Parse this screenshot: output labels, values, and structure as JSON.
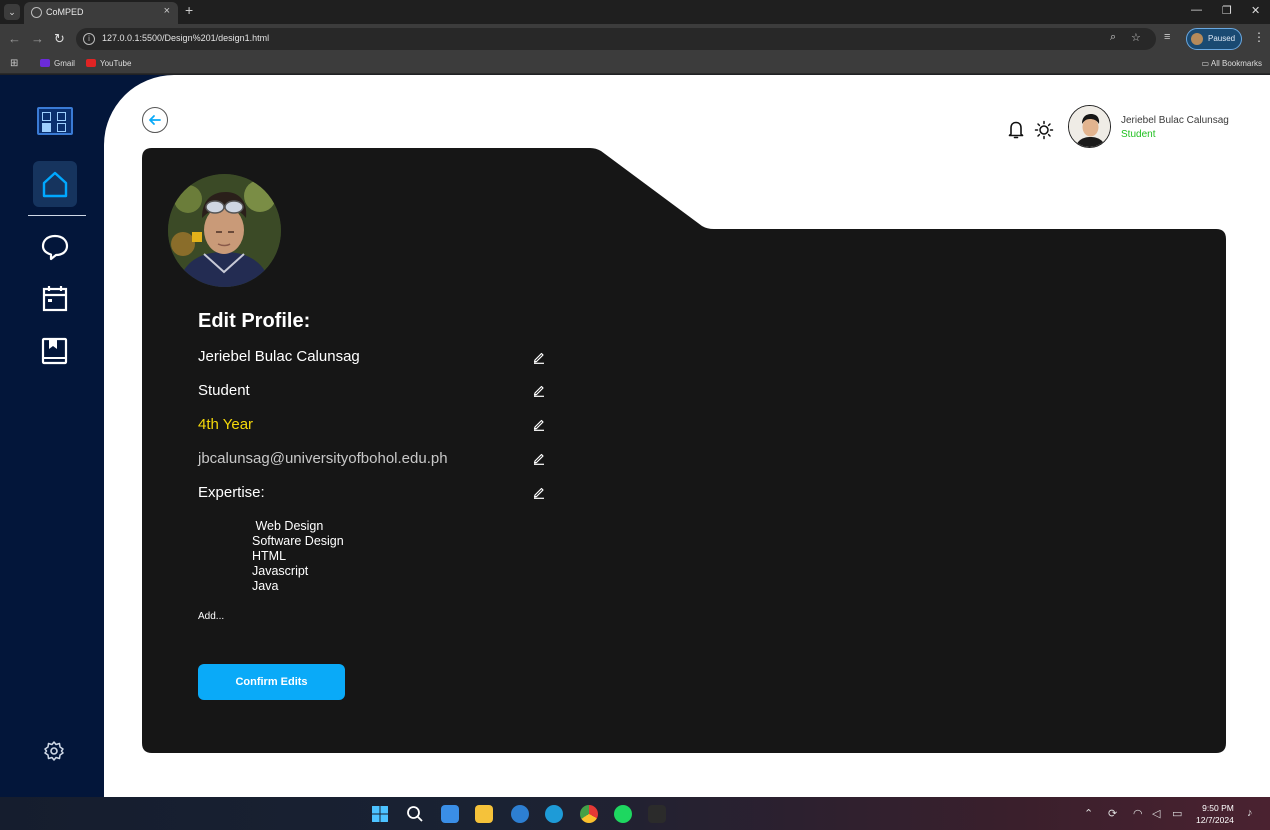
{
  "browser": {
    "tab_title": "CoMPED",
    "url": "127.0.0.1:5500/Design%201/design1.html",
    "profile_status": "Paused",
    "bookmarks": [
      {
        "label": "Gmail",
        "color": "#6b2bd9"
      },
      {
        "label": "YouTube",
        "color": "#e02424"
      }
    ],
    "all_bookmarks": "All Bookmarks"
  },
  "sidebar": {
    "items": [
      {
        "name": "home",
        "active": true
      },
      {
        "name": "messages",
        "active": false
      },
      {
        "name": "calendar",
        "active": false
      },
      {
        "name": "library",
        "active": false
      }
    ],
    "accent": "#00a8ff"
  },
  "header": {
    "user_name": "Jeriebel Bulac Calunsag",
    "user_role": "Student"
  },
  "profile": {
    "heading": "Edit Profile:",
    "name": "Jeriebel Bulac Calunsag",
    "role": "Student",
    "year": "4th Year",
    "email": "jbcalunsag@universityofbohol.edu.ph",
    "expertise_label": "Expertise:",
    "expertise": [
      " Web Design",
      "Software Design",
      "HTML",
      "Javascript",
      "Java"
    ],
    "add_label": "Add...",
    "confirm_label": "Confirm Edits",
    "colors": {
      "card": "#161616",
      "year": "#f5d90a",
      "email": "#c8c8c8",
      "button": "#0aaaf8"
    }
  },
  "taskbar": {
    "time": "9:50 PM",
    "date": "12/7/2024"
  }
}
